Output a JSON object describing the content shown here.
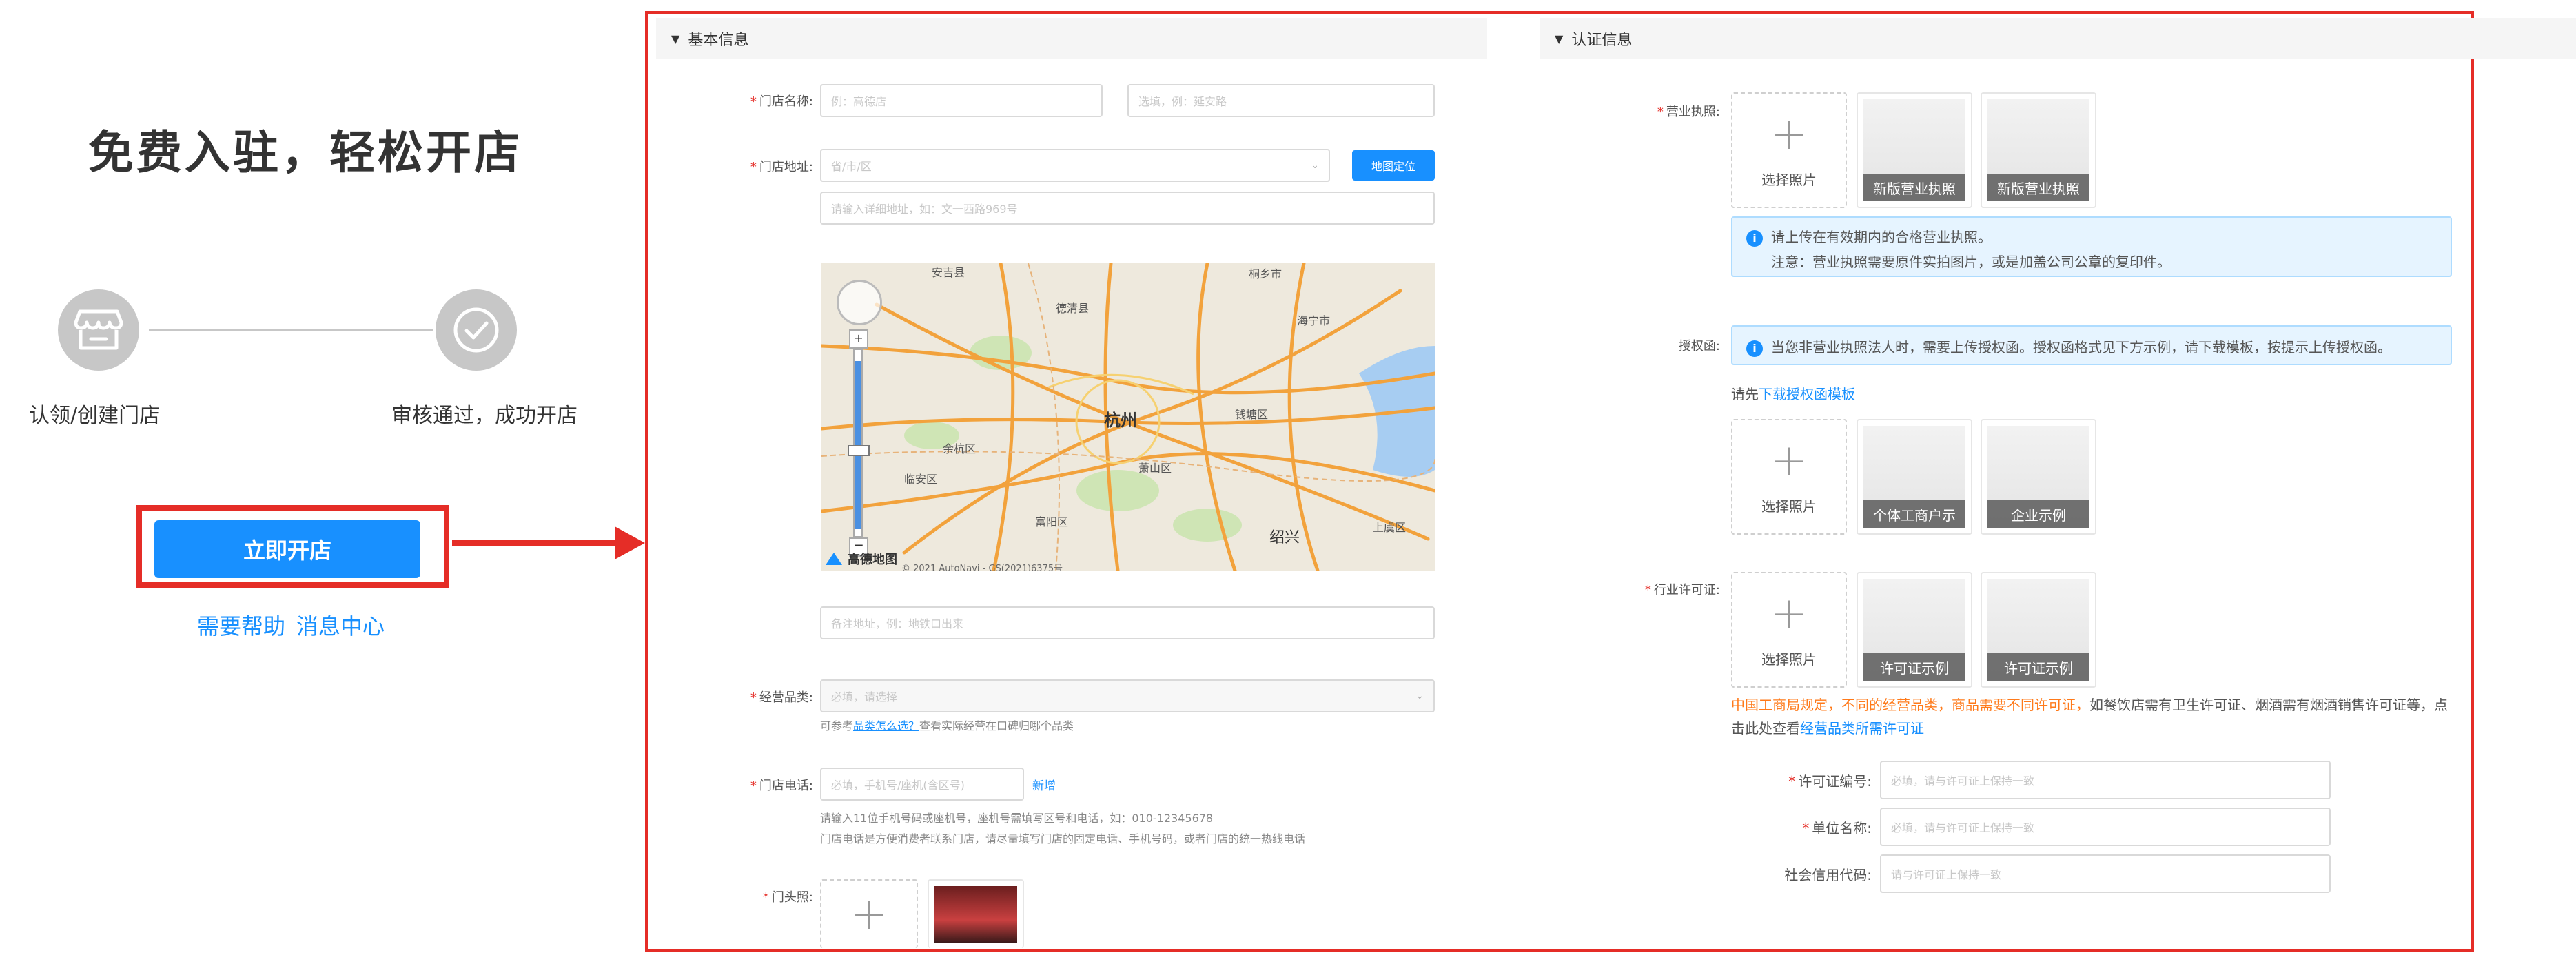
{
  "intro": {
    "title": "免费入驻，轻松开店",
    "steps": [
      {
        "label": "认领/创建门店",
        "icon": "store-icon"
      },
      {
        "label": "审核通过，成功开店",
        "icon": "check-circle-icon"
      }
    ],
    "cta_label": "立即开店",
    "help_links": [
      "需要帮助",
      "消息中心"
    ]
  },
  "colors": {
    "accent": "#1890ff",
    "highlight": "#e52d27",
    "warning": "#ff7a1a"
  },
  "basic": {
    "section_title": "基本信息",
    "store_name": {
      "label": "门店名称:",
      "placeholder1": "例：高德店",
      "placeholder2": "选填，例：延安路"
    },
    "store_address": {
      "label": "门店地址:",
      "select_placeholder": "省/市/区",
      "map_button": "地图定位",
      "detail_placeholder": "请输入详细地址，如：文一西路969号"
    },
    "map": {
      "city": "杭州",
      "logo_text": "高德地图",
      "copyright": "© 2021 AutoNavi - GS(2021)6375号",
      "places": [
        "余杭区",
        "临安区",
        "富阳区",
        "萧山区",
        "钱塘区",
        "绍兴",
        "上虞区",
        "海宁市",
        "桐乡市",
        "德清县",
        "安吉县"
      ]
    },
    "remark_placeholder": "备注地址，例：地铁口出来",
    "category": {
      "label": "经营品类:",
      "placeholder": "必填，请选择",
      "hint_prefix": "可参考",
      "hint_link": "品类怎么选？",
      "hint_suffix": "查看实际经营在口碑归哪个品类"
    },
    "phone": {
      "label": "门店电话:",
      "placeholder": "必填，手机号/座机(含区号)",
      "add_label": "新增",
      "hint1": "请输入11位手机号码或座机号，座机号需填写区号和电话，如：010-12345678",
      "hint2": "门店电话是方便消费者联系门店，请尽量填写门店的固定电话、手机号码，或者门店的统一热线电话"
    },
    "storefront": {
      "label": "门头照:"
    }
  },
  "auth": {
    "section_title": "认证信息",
    "license": {
      "label": "营业执照:",
      "upload_label": "选择照片",
      "samples": [
        "新版营业执照",
        "新版营业执照"
      ],
      "note1": "请上传在有效期内的合格营业执照。",
      "note2": "注意：营业执照需要原件实拍图片，或是加盖公司公章的复印件。"
    },
    "authorization": {
      "label": "授权函:",
      "note": "当您非营业执照法人时，需要上传授权函。授权函格式见下方示例，请下载模板，按提示上传授权函。",
      "download_prefix": "请先",
      "download_link": "下载授权函模板",
      "upload_label": "选择照片",
      "samples": [
        "个体工商户示",
        "企业示例"
      ]
    },
    "industry_permit": {
      "label": "行业许可证:",
      "upload_label": "选择照片",
      "samples": [
        "许可证示例",
        "许可证示例"
      ],
      "warn": "中国工商局规定，不同的经营品类，商品需要不同许可证，",
      "text": "如餐饮店需有卫生许可证、烟酒需有烟酒销售许可证等，点击此处查看",
      "link": "经营品类所需许可证"
    },
    "permit_no": {
      "label": "许可证编号:",
      "placeholder": "必填，请与许可证上保持一致"
    },
    "unit_name": {
      "label": "单位名称:",
      "placeholder": "必填，请与许可证上保持一致"
    },
    "credit_code": {
      "label": "社会信用代码:",
      "placeholder": "请与许可证上保持一致"
    }
  }
}
